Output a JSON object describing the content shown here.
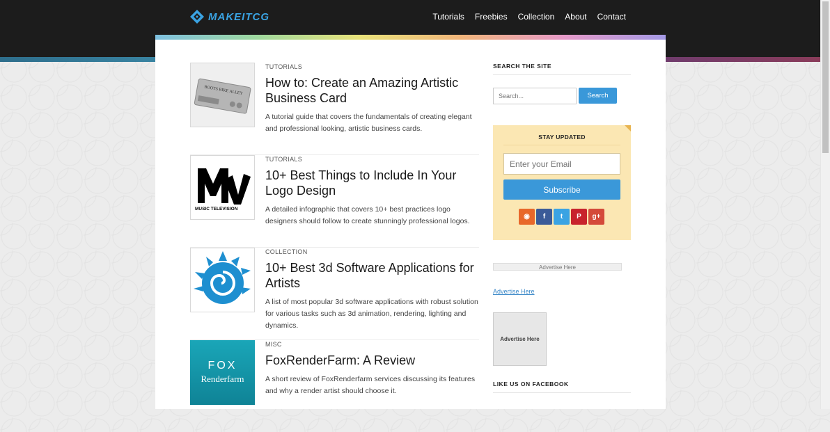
{
  "header": {
    "logo_text": "MAKEITCG",
    "nav": [
      {
        "label": "Tutorials"
      },
      {
        "label": "Freebies"
      },
      {
        "label": "Collection"
      },
      {
        "label": "About"
      },
      {
        "label": "Contact"
      }
    ]
  },
  "posts": [
    {
      "category": "TUTORIALS",
      "title": "How to: Create an Amazing Artistic Business Card",
      "excerpt": "A tutorial guide that covers the fundamentals of creating elegant and professional looking, artistic business cards.",
      "thumb": {
        "icon": "business-card-icon",
        "card_text": "BOOTS BIKE ALLEY"
      }
    },
    {
      "category": "TUTORIALS",
      "title": "10+ Best Things to Include In Your Logo Design",
      "excerpt": "A detailed infographic that covers 10+ best practices logo designers should follow to create stunningly professional logos.",
      "thumb": {
        "icon": "mtv-logo-icon",
        "caption": "MUSIC TELEVISION"
      }
    },
    {
      "category": "COLLECTION",
      "title": "10+ Best 3d Software Applications for Artists",
      "excerpt": "A list of most popular 3d software applications with robust solution for various tasks such as 3d animation, rendering, lighting and dynamics.",
      "thumb": {
        "icon": "spiral-logo-icon"
      }
    },
    {
      "category": "MISC",
      "title": "FoxRenderFarm: A Review",
      "excerpt": "A short review of FoxRenderfarm services discussing its features and why a render artist should choose it.",
      "thumb": {
        "icon": "fox-renderfarm-logo",
        "line1": "FOX",
        "line2": "Renderfarm"
      }
    }
  ],
  "sidebar": {
    "search_heading": "SEARCH THE SITE",
    "search_placeholder": "Search...",
    "search_button": "Search",
    "stay_heading": "STAY UPDATED",
    "email_placeholder": "Enter your Email",
    "subscribe_button": "Subscribe",
    "social": [
      {
        "icon": "rss-icon",
        "glyph": "◉",
        "color": "#e8682a"
      },
      {
        "icon": "facebook-icon",
        "glyph": "f",
        "color": "#3b5b98"
      },
      {
        "icon": "twitter-icon",
        "glyph": "t",
        "color": "#3aa3e3"
      },
      {
        "icon": "pinterest-icon",
        "glyph": "P",
        "color": "#c8232c"
      },
      {
        "icon": "google-plus-icon",
        "glyph": "g+",
        "color": "#d44a3a"
      }
    ],
    "ad_bar": "Advertise Here",
    "ad_link": "Advertise Here",
    "ad_box": "Advertise Here",
    "like_heading": "LIKE US ON FACEBOOK"
  },
  "colors": {
    "accent": "#3a98d9",
    "header_bg": "#1c1c1c",
    "newsletter_bg": "#fbe7b3"
  }
}
